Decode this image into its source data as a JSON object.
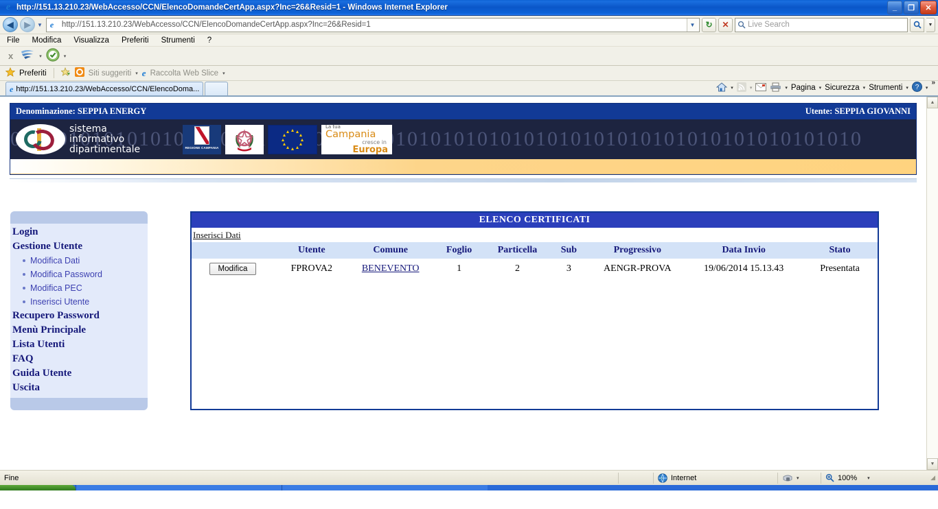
{
  "window": {
    "title": "http://151.13.210.23/WebAccesso/CCN/ElencoDomandeCertApp.aspx?Inc=26&Resid=1 - Windows Internet Explorer",
    "minimize": "_",
    "maximize": "❐",
    "close": "✕"
  },
  "address": {
    "url_prefix": "http://",
    "url_host": "151.13.210.23",
    "url_path": "/WebAccesso/CCN/ElencoDomandeCertApp.aspx?Inc=26&Resid=1",
    "full_url": "http://151.13.210.23/WebAccesso/CCN/ElencoDomandeCertApp.aspx?Inc=26&Resid=1",
    "back_glyph": "◀",
    "forward_glyph": "▶",
    "history_drop": "▼",
    "refresh_glyph": "↻",
    "stop_glyph": "✕",
    "search_placeholder": "Live Search",
    "search_value": ""
  },
  "menubar": {
    "items": [
      "File",
      "Modifica",
      "Visualizza",
      "Preferiti",
      "Strumenti",
      "?"
    ]
  },
  "addonbar": {
    "close_label": "x",
    "drop_glyph": "▾"
  },
  "favbar": {
    "favorites_label": "Preferiti",
    "suggested_label": "Siti suggeriti",
    "webslice_label": "Raccolta Web Slice",
    "drop_glyph": "▾"
  },
  "tabs": [
    {
      "label": "http://151.13.210.23/WebAccesso/CCN/ElencoDoma...",
      "active": true
    },
    {
      "label": "",
      "active": false
    }
  ],
  "commandbar": {
    "items": [
      "Pagina",
      "Sicurezza",
      "Strumenti"
    ],
    "home_icon": "home-icon",
    "feeds_icon": "rss-icon",
    "mail_icon": "mail-icon",
    "print_icon": "printer-icon",
    "help_icon": "help-icon",
    "overflow_glyph": "»",
    "drop_glyph": "▾"
  },
  "page": {
    "header": {
      "denominazione_label": "Denominazione: SEPPIA ENERGY",
      "utente_label": "Utente: SEPPIA GIOVANNI"
    },
    "banner": {
      "logo_line1": "sistema",
      "logo_line2": "informativo",
      "logo_line3": "dipartimentale",
      "regione_caption": "REGIONE CAMPANIA",
      "campania_l1": "La tua",
      "campania_l2": "Campania",
      "campania_l3": "cresce in",
      "campania_l4": "Europa",
      "binary_text": "0101010101010101010101010101010101010101010101010101010101010101010101010"
    },
    "sidebar": {
      "items": [
        {
          "label": "Login",
          "type": "link"
        },
        {
          "label": "Gestione Utente",
          "type": "link"
        },
        {
          "label": "Modifica Dati",
          "type": "sub"
        },
        {
          "label": "Modifica Password",
          "type": "sub"
        },
        {
          "label": "Modifica PEC",
          "type": "sub"
        },
        {
          "label": "Inserisci Utente",
          "type": "sub"
        },
        {
          "label": "Recupero Password",
          "type": "link"
        },
        {
          "label": "Menù Principale",
          "type": "link"
        },
        {
          "label": "Lista Utenti",
          "type": "link"
        },
        {
          "label": "FAQ",
          "type": "link"
        },
        {
          "label": "Guida Utente",
          "type": "link"
        },
        {
          "label": "Uscita",
          "type": "link"
        }
      ]
    },
    "panel": {
      "title": "ELENCO CERTIFICATI",
      "insert_link": "Inserisci Dati",
      "columns": [
        "",
        "Utente",
        "Comune",
        "Foglio",
        "Particella",
        "Sub",
        "Progressivo",
        "Data Invio",
        "Stato"
      ],
      "rows": [
        {
          "action": "Modifica",
          "utente": "FPROVA2",
          "comune": "BENEVENTO",
          "foglio": "1",
          "particella": "2",
          "sub": "3",
          "progressivo": "AENGR-PROVA",
          "data_invio": "19/06/2014 15.13.43",
          "stato": "Presentata"
        }
      ]
    }
  },
  "scrollbar": {
    "up_glyph": "▲",
    "down_glyph": "▼"
  },
  "statusbar": {
    "status_text": "Fine",
    "zone_text": "Internet",
    "zoom_text": "100%",
    "zone_icon": "globe-icon",
    "protected_icon": "lock-icon",
    "zoom_icon": "magnifier-plus-icon",
    "drop_glyph": "▾",
    "grip": "◢"
  },
  "colors": {
    "title_blue": "#0a56c8",
    "site_blue": "#123a96",
    "panel_blue": "#2b3fbb",
    "header_row": "#d3e2f7",
    "sidebar_bg": "#e3eafa",
    "sidebar_cap": "#b9c9e8",
    "link_navy": "#15187a",
    "gold": "#fdd58a"
  }
}
